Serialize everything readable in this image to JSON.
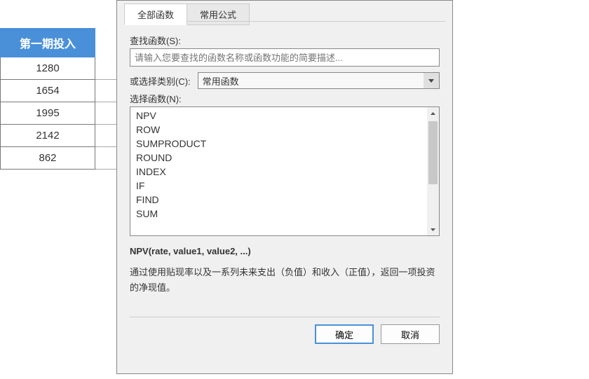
{
  "spreadsheet": {
    "header": "第一期投入",
    "rows": [
      "1280",
      "1654",
      "1995",
      "2142",
      "862"
    ]
  },
  "dialog": {
    "tabs": {
      "all": "全部函数",
      "common": "常用公式"
    },
    "search": {
      "label": "查找函数(S):",
      "placeholder": "请输入您要查找的函数名称或函数功能的简要描述..."
    },
    "category": {
      "label": "或选择类别(C):",
      "value": "常用函数"
    },
    "select": {
      "label": "选择函数(N):"
    },
    "functions": [
      "NPV",
      "ROW",
      "SUMPRODUCT",
      "ROUND",
      "INDEX",
      "IF",
      "FIND",
      "SUM"
    ],
    "signature": "NPV(rate, value1, value2, ...)",
    "description": "通过使用贴现率以及一系列未来支出（负值）和收入（正值），返回一项投资的净现值。",
    "buttons": {
      "ok": "确定",
      "cancel": "取消"
    }
  }
}
